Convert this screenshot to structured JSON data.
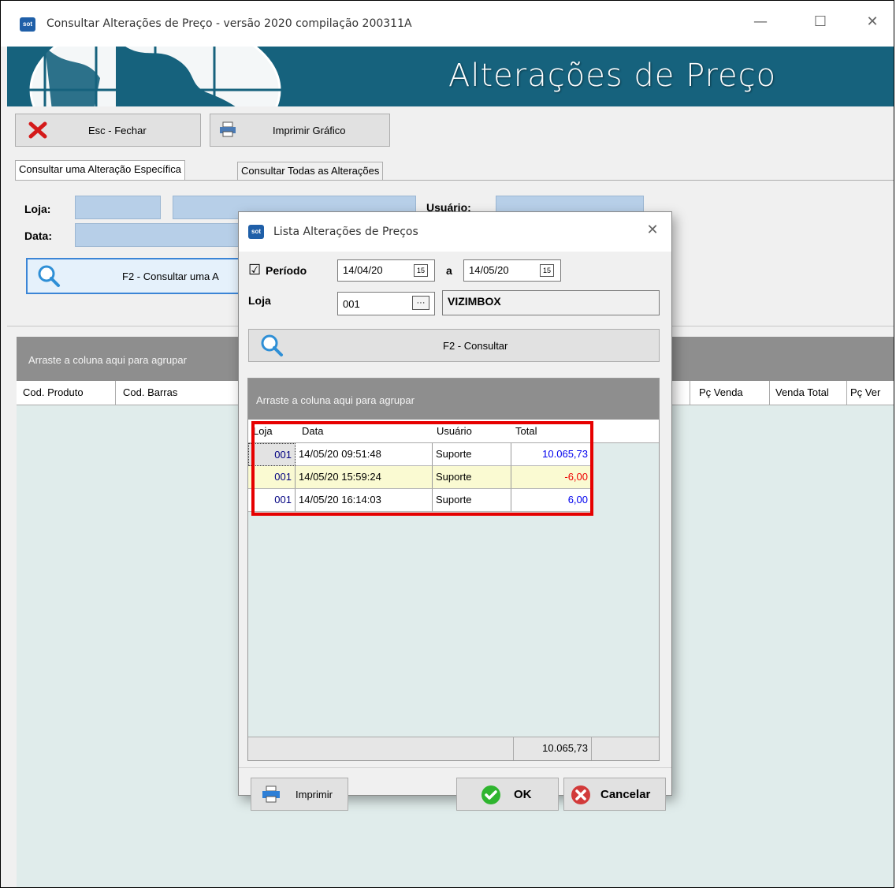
{
  "main": {
    "title": "Consultar Alterações de Preço -  versão 2020 compilação 200311A",
    "app_icon_text": "sot",
    "controls": {
      "minimize": "—",
      "maximize": "☐",
      "close": "✕"
    },
    "banner_title": "Alterações de Preço",
    "banner_color": "#16627d",
    "toolbar": {
      "close_label": "Esc - Fechar",
      "print_label": "Imprimir Gráfico"
    },
    "tabs": [
      {
        "label": "Consultar uma Alteração Específica"
      },
      {
        "label": "Consultar Todas as Alterações"
      }
    ],
    "form": {
      "loja_label": "Loja:",
      "data_label": "Data:",
      "usuario_label": "Usuário:",
      "consult_button": "F2 - Consultar uma A"
    },
    "grid": {
      "group_hint": "Arraste a coluna aqui para agrupar",
      "columns": [
        "Cod. Produto",
        "Cod. Barras",
        "Pç Venda",
        "Venda Total",
        "Pç Ver"
      ]
    }
  },
  "dialog": {
    "title": "Lista Alterações de Preços",
    "app_icon_text": "sot",
    "close": "✕",
    "periodo_label": "Período",
    "periodo_checked": "☑",
    "date_from": "14/04/20",
    "a_label": "a",
    "date_to": "14/05/20",
    "cal_icon": "15",
    "loja_label": "Loja",
    "loja_code": "001",
    "ellipsis": "···",
    "loja_name": "VIZIMBOX",
    "consult_button": "F2 - Consultar",
    "group_hint": "Arraste a coluna aqui para agrupar",
    "columns": [
      "Loja",
      "Data",
      "Usuário",
      "Total"
    ],
    "rows": [
      {
        "loja": "001",
        "data": "14/05/20 09:51:48",
        "usuario": "Suporte",
        "total": "10.065,73",
        "total_color": "#0000ee"
      },
      {
        "loja": "001",
        "data": "14/05/20 15:59:24",
        "usuario": "Suporte",
        "total": "-6,00",
        "total_color": "#ee0000"
      },
      {
        "loja": "001",
        "data": "14/05/20 16:14:03",
        "usuario": "Suporte",
        "total": "6,00",
        "total_color": "#0000ee"
      }
    ],
    "footer_total": "10.065,73",
    "print_button": "Imprimir",
    "ok_button": "OK",
    "cancel_button": "Cancelar",
    "highlight_color": "#e60000"
  }
}
